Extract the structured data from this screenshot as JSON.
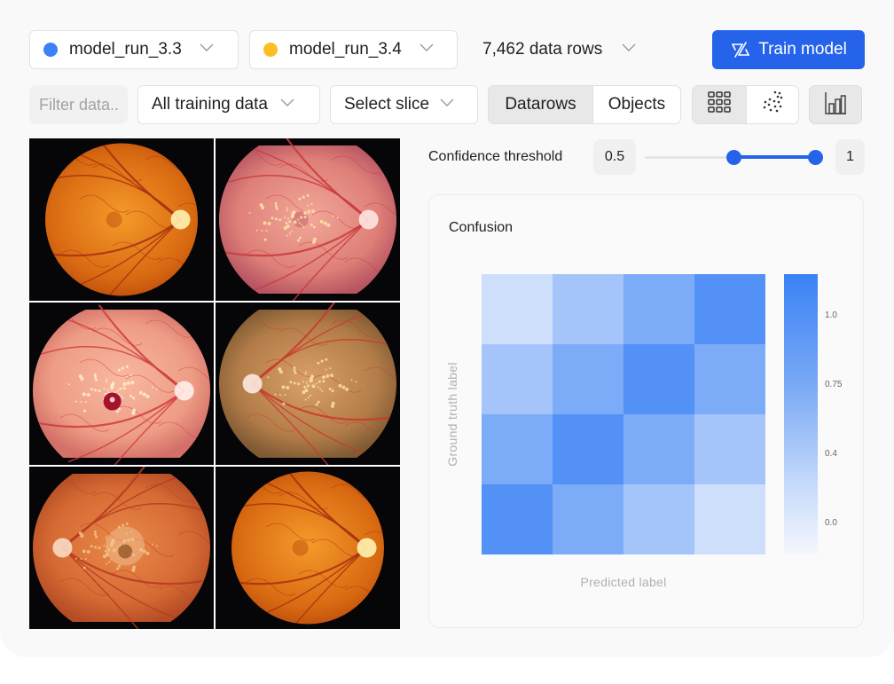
{
  "toolbar": {
    "model_a": {
      "label": "model_run_3.3",
      "color": "#3b82f6"
    },
    "model_b": {
      "label": "model_run_3.4",
      "color": "#fbbf24"
    },
    "rows_count": "7,462 data rows",
    "train_button": "Train model",
    "accent_color": "#2563eb"
  },
  "filters": {
    "filter_placeholder": "Filter data..",
    "dataset_select": "All training data",
    "slice_select": "Select slice",
    "view_mode": {
      "options": [
        "Datarows",
        "Objects"
      ],
      "active": "Datarows"
    },
    "layout_mode": {
      "options": [
        "grid-icon",
        "scatter-icon"
      ],
      "active": "grid-icon"
    },
    "chart_toggle": "bar-chart-icon"
  },
  "gallery": {
    "images": [
      {
        "alt": "Healthy retina fundus image (right eye)",
        "style": "orange"
      },
      {
        "alt": "Retina fundus with drusen deposits",
        "style": "pink-drusen"
      },
      {
        "alt": "Retina fundus with macular hemorrhage",
        "style": "pink-hemorrhage"
      },
      {
        "alt": "Retina fundus with dense drusen (left eye)",
        "style": "olive-drusen"
      },
      {
        "alt": "Retina fundus with macular degeneration (left eye)",
        "style": "orange-lesion"
      },
      {
        "alt": "Healthy retina fundus image (right eye)",
        "style": "orange"
      }
    ]
  },
  "confidence": {
    "label": "Confidence threshold",
    "min_value": "0.5",
    "max_value": "1",
    "range_min": 0,
    "range_max": 1,
    "lower": 0.5,
    "upper": 1
  },
  "confusion_panel": {
    "title": "Confusion"
  },
  "chart_data": {
    "type": "heatmap",
    "title": "Confusion",
    "xlabel": "Predicted label",
    "ylabel": "Ground truth label",
    "x_categories": [
      "",
      "",
      "",
      ""
    ],
    "y_categories": [
      "",
      "",
      "",
      ""
    ],
    "values": [
      [
        0.1,
        0.35,
        0.6,
        0.85
      ],
      [
        0.35,
        0.6,
        0.85,
        0.6
      ],
      [
        0.6,
        0.85,
        0.6,
        0.35
      ],
      [
        0.85,
        0.6,
        0.35,
        0.1
      ]
    ],
    "colorbar": {
      "ticks": [
        "1.0",
        "0.75",
        "0.4",
        "0.0"
      ],
      "color_low": "#f4f7fd",
      "color_high": "#3b82f6"
    },
    "grid": false
  }
}
